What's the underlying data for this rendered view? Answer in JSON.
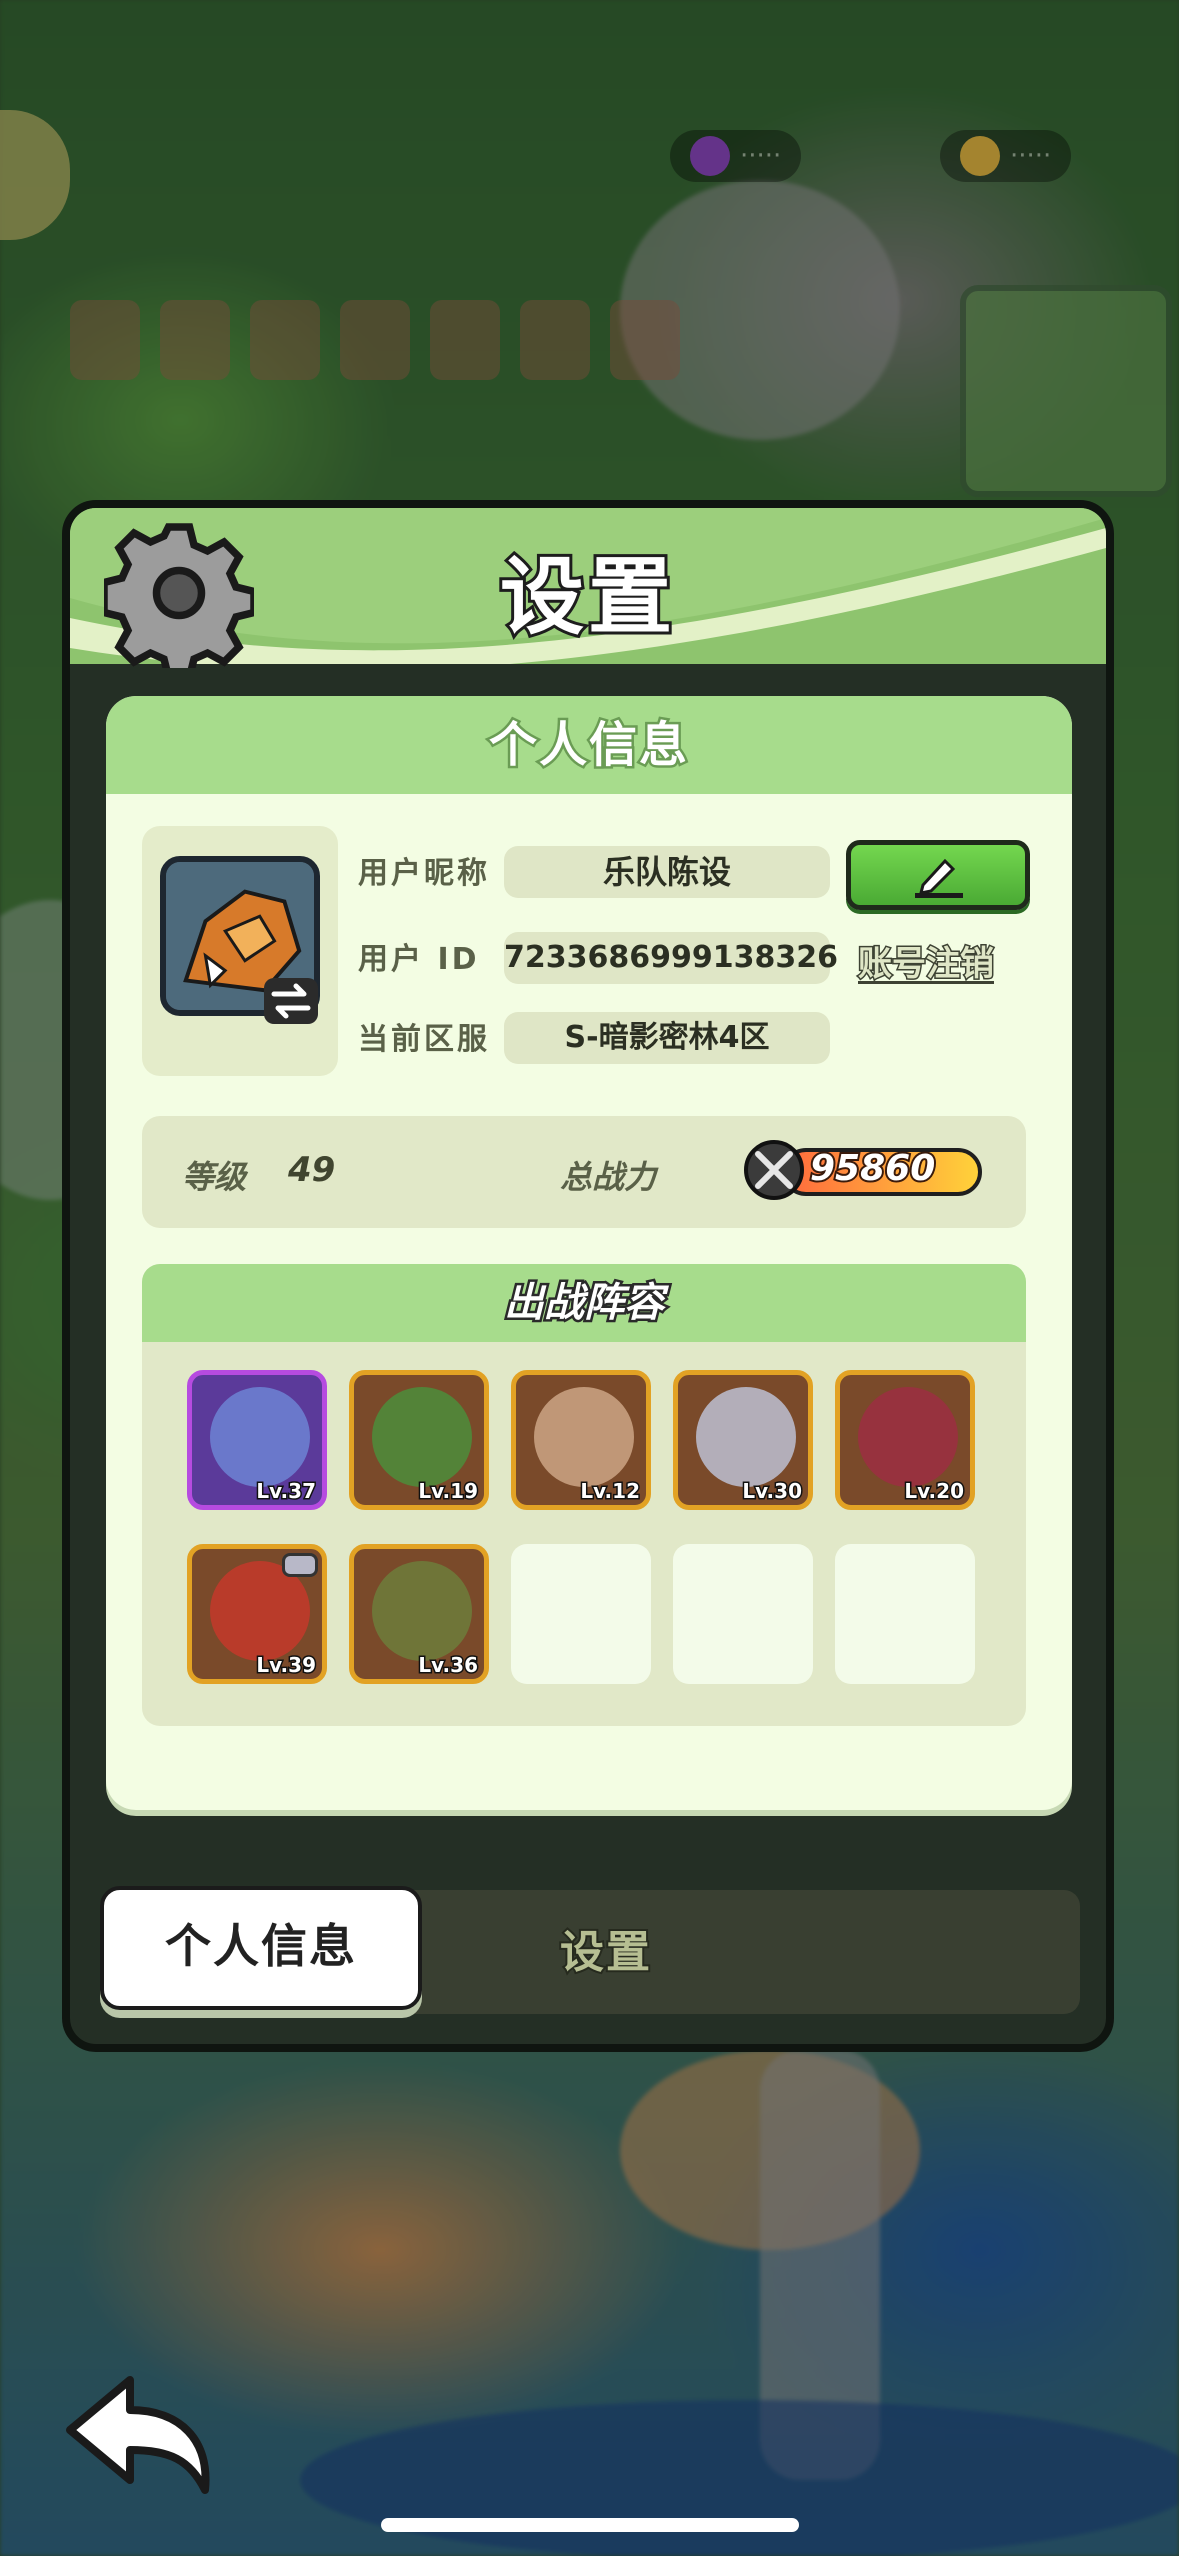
{
  "panel": {
    "title": "设置"
  },
  "profile": {
    "section_title": "个人信息",
    "nickname_label": "用户昵称",
    "nickname_value": "乐队陈设",
    "user_id_label": "用户 ID",
    "user_id_value": "7233686999138326",
    "server_label": "当前区服",
    "server_value": "S-暗影密林4区",
    "logout_label": "账号注销",
    "edit_icon": "pencil-icon",
    "swap_icon": "swap-arrows-icon"
  },
  "stats": {
    "level_label": "等级",
    "level_value": "49",
    "power_label": "总战力",
    "power_value": "95860",
    "power_icon": "crossed-swords-icon"
  },
  "lineup": {
    "title": "出战阵容",
    "heroes": [
      {
        "level": "Lv.37",
        "color": "#6b7fd0",
        "frame": "purple"
      },
      {
        "level": "Lv.19",
        "color": "#4f8a3a",
        "frame": "gold"
      },
      {
        "level": "Lv.12",
        "color": "#c8a080",
        "frame": "gold"
      },
      {
        "level": "Lv.30",
        "color": "#b9b9c9",
        "frame": "gold"
      },
      {
        "level": "Lv.20",
        "color": "#9a3040",
        "frame": "gold"
      },
      {
        "level": "Lv.39",
        "color": "#c03a2a",
        "frame": "gold"
      },
      {
        "level": "Lv.36",
        "color": "#6e7a3a",
        "frame": "gold"
      }
    ],
    "empty_slots": 3
  },
  "tabs": {
    "active": "个人信息",
    "inactive": "设置"
  },
  "nav": {
    "back_icon": "back-arrow-icon"
  },
  "colors": {
    "header_green": "#8ec46e",
    "card_bg": "#f3fde3",
    "edit_button": "#5cc03d",
    "power_gradient_start": "#ff6a3d",
    "power_gradient_end": "#ffd23a"
  }
}
